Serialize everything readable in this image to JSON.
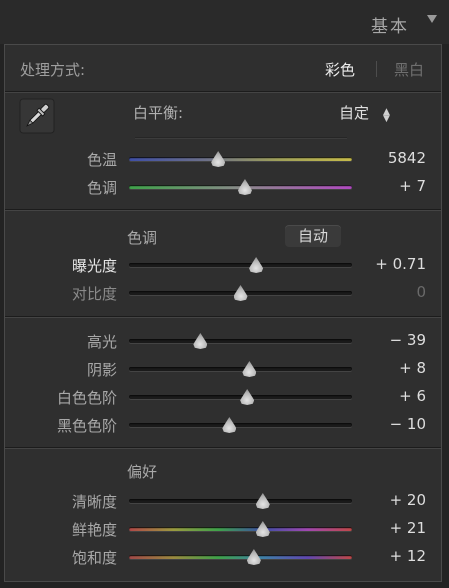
{
  "header": {
    "title": "基本"
  },
  "mode": {
    "label": "处理方式:",
    "options": [
      "彩色",
      "黑白"
    ],
    "selected": "彩色"
  },
  "white_balance": {
    "label": "白平衡:",
    "value": "自定",
    "arrows": "▲▼"
  },
  "wb_sliders": [
    {
      "label": "色温",
      "value": "5842",
      "position": 0.4,
      "track": "temp"
    },
    {
      "label": "色调",
      "value": "+ 7",
      "position": 0.52,
      "track": "tint"
    }
  ],
  "tone": {
    "label": "色调",
    "auto": "自动"
  },
  "tone_sliders": [
    {
      "label": "曝光度",
      "value": "+ 0.71",
      "position": 0.57,
      "style": "bright"
    },
    {
      "label": "对比度",
      "value": "0",
      "position": 0.5,
      "style": "dim"
    }
  ],
  "light_sliders": [
    {
      "label": "高光",
      "value": "− 39",
      "position": 0.32
    },
    {
      "label": "阴影",
      "value": "+ 8",
      "position": 0.54
    },
    {
      "label": "白色色阶",
      "value": "+ 6",
      "position": 0.53
    },
    {
      "label": "黑色色阶",
      "value": "− 10",
      "position": 0.45
    }
  ],
  "presence": {
    "label": "偏好"
  },
  "presence_sliders": [
    {
      "label": "清晰度",
      "value": "+ 20",
      "position": 0.6,
      "track": ""
    },
    {
      "label": "鲜艳度",
      "value": "+ 21",
      "position": 0.6,
      "track": "vib"
    },
    {
      "label": "饱和度",
      "value": "+ 12",
      "position": 0.56,
      "track": "sat"
    }
  ]
}
